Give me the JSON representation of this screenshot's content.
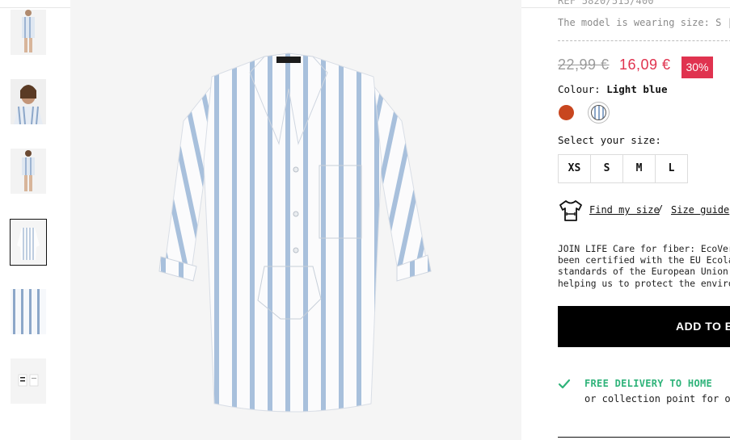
{
  "product": {
    "ref_text": "REF 5820/515/400",
    "model_note": "The model is wearing size: S | Model h",
    "old_price": "22,99 €",
    "new_price": "16,09 €",
    "discount": "30%",
    "colour_label": "Colour:",
    "colour_value": "Light blue",
    "colours": [
      {
        "name": "rust",
        "hex": "#c8461f"
      },
      {
        "name": "light-blue-stripe",
        "hex": "#8ca7c9",
        "selected": true
      }
    ],
    "size_title": "Select your size:",
    "sizes": [
      "XS",
      "S",
      "M",
      "L"
    ],
    "find_my_size": "Find my size",
    "separator": "/",
    "size_guide": "Size guide",
    "care_lines": [
      "JOIN LIFE Care for fiber: EcoVero™ Vi",
      "been certified with the EU Ecolabel ar",
      "standards of the European Union from",
      "helping us to protect the environment"
    ],
    "add_button": "ADD TO B",
    "delivery_title": "FREE DELIVERY TO HOME",
    "delivery_sub": "or collection point for orders"
  },
  "gallery": {
    "thumbnail_count": 6,
    "selected_index": 3
  },
  "colors": {
    "accent": "#e0334f",
    "success": "#2fb37a",
    "stripe": "#8ca7c9"
  }
}
